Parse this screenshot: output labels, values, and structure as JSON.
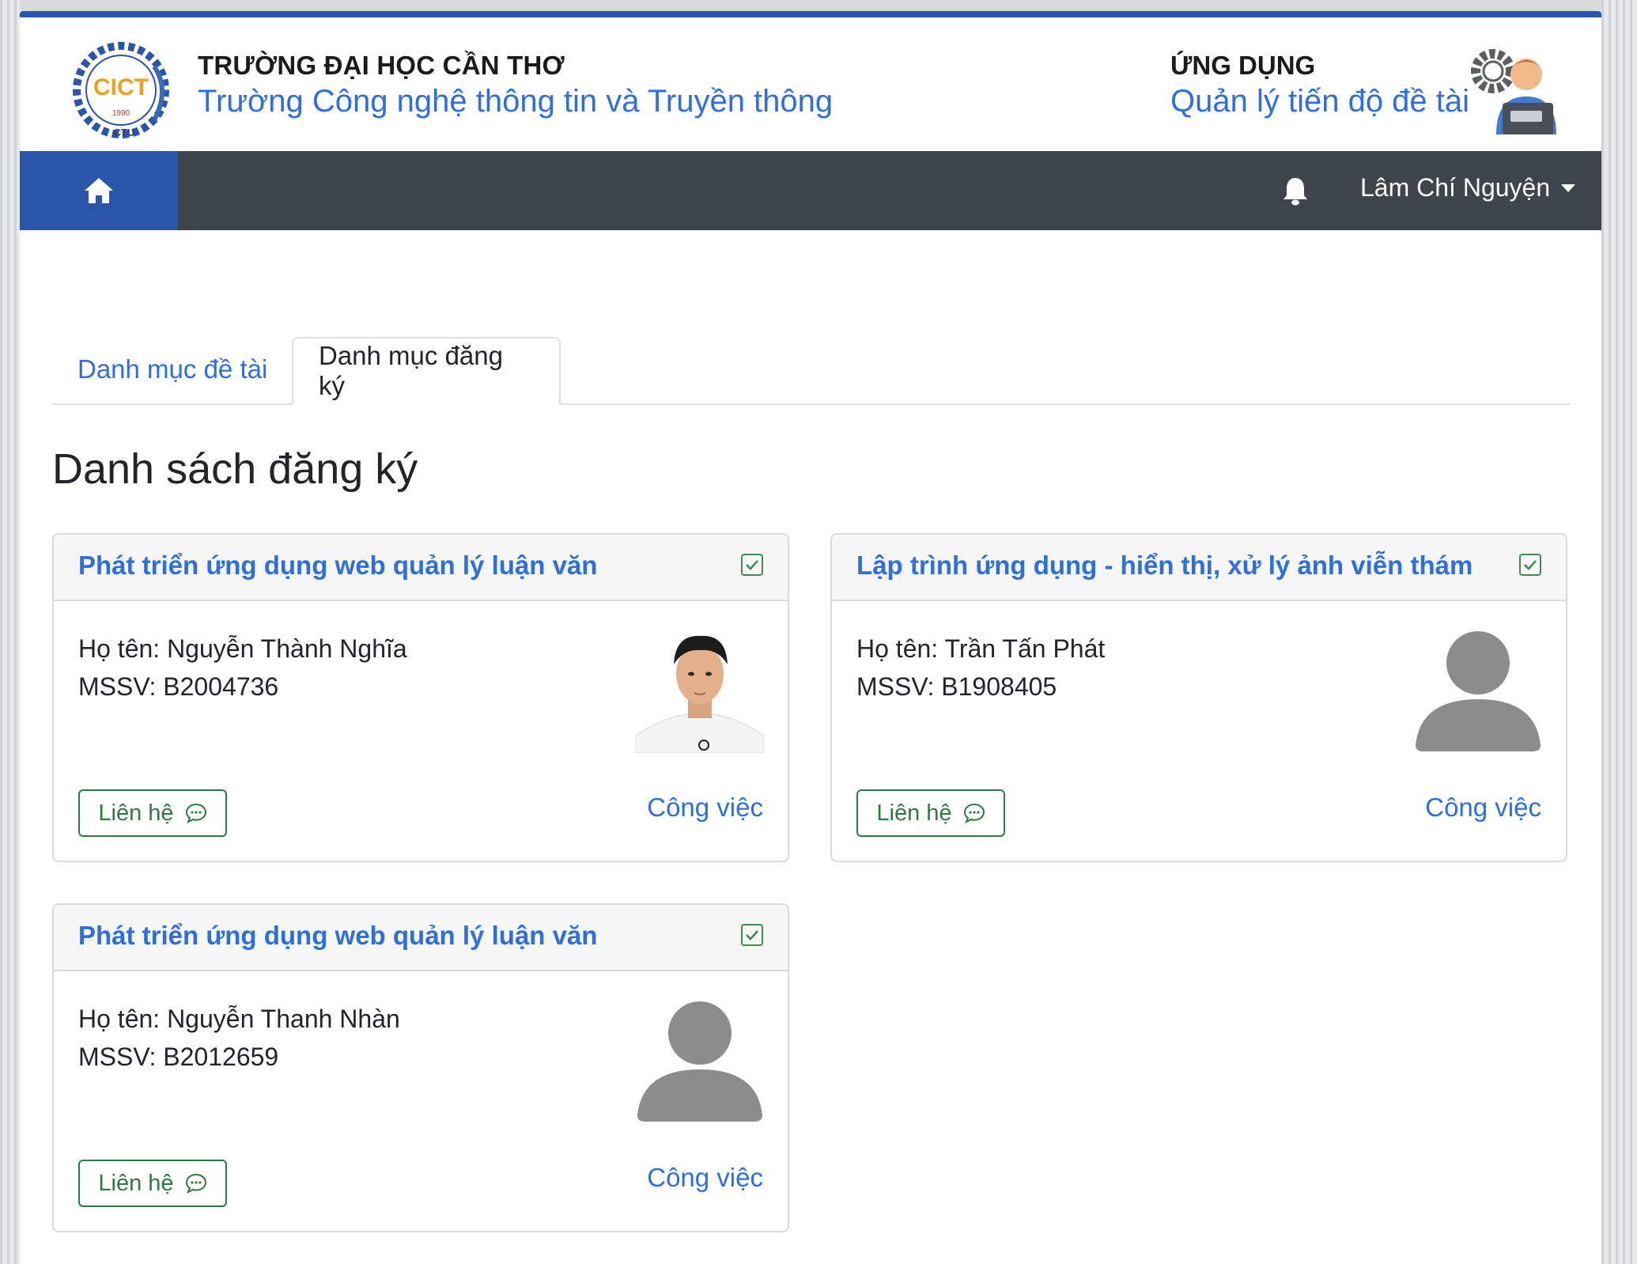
{
  "header": {
    "university_title": "TRƯỜNG ĐẠI HỌC CẦN THƠ",
    "college_name": "Trường Công nghệ thông tin và Truyền thông",
    "app_label": "ỨNG DỤNG",
    "app_name": "Quản lý tiến độ đề tài",
    "logo_text": "CICT",
    "logo_year": "1990",
    "logo_sub": "CTU"
  },
  "navbar": {
    "user_name": "Lâm Chí Nguyện",
    "home_icon": "home-icon",
    "bell_icon": "bell-icon"
  },
  "tabs": [
    {
      "label": "Danh mục đề tài",
      "active": false
    },
    {
      "label": "Danh mục đăng ký",
      "active": true
    }
  ],
  "page_title": "Danh sách đăng ký",
  "cards": [
    {
      "title": "Phát triển ứng dụng web quản lý luận văn",
      "name_line": "Họ tên: Nguyễn Thành Nghĩa",
      "id_line": "MSSV: B2004736",
      "contact_label": "Liên hệ",
      "work_label": "Công việc",
      "avatar": "student-photo"
    },
    {
      "title": "Lập trình ứng dụng - hiển thị, xử lý ảnh viễn thám",
      "name_line": "Họ tên: Trần Tấn Phát",
      "id_line": "MSSV: B1908405",
      "contact_label": "Liên hệ",
      "work_label": "Công việc",
      "avatar": "default-avatar"
    },
    {
      "title": "Phát triển ứng dụng web quản lý luận văn",
      "name_line": "Họ tên: Nguyễn Thanh Nhàn",
      "id_line": "MSSV: B2012659",
      "contact_label": "Liên hệ",
      "work_label": "Công việc",
      "avatar": "default-avatar"
    }
  ],
  "colors": {
    "primary": "#2e6fe0",
    "nav_dark": "#3e444c",
    "nav_blue": "#2a55a8",
    "success": "#2e7a44"
  }
}
